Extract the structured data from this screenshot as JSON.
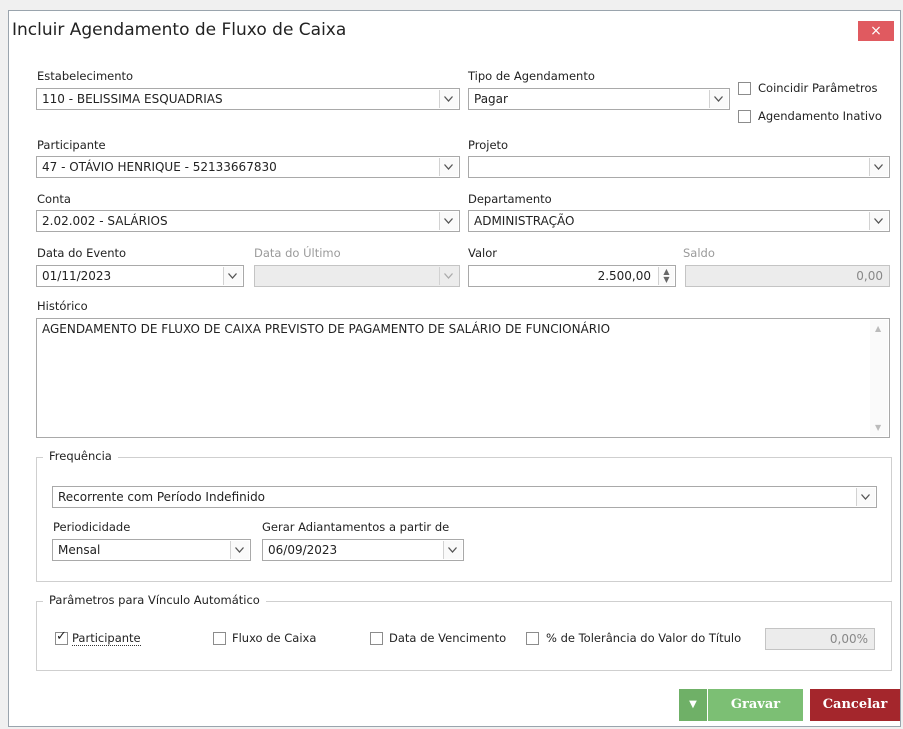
{
  "dialog": {
    "title": "Incluir Agendamento de Fluxo de Caixa",
    "close_label": "×"
  },
  "form": {
    "estabelecimento": {
      "label": "Estabelecimento",
      "value": "110 - BELISSIMA ESQUADRIAS"
    },
    "tipo_agendamento": {
      "label": "Tipo de Agendamento",
      "value": "Pagar"
    },
    "coincidir_parametros": {
      "label": "Coincidir Parâmetros",
      "checked": false
    },
    "agendamento_inativo": {
      "label": "Agendamento Inativo",
      "checked": false
    },
    "participante": {
      "label": "Participante",
      "value": "47 - OTÁVIO HENRIQUE - 52133667830"
    },
    "projeto": {
      "label": "Projeto",
      "value": ""
    },
    "conta": {
      "label": "Conta",
      "value": "2.02.002 - SALÁRIOS"
    },
    "departamento": {
      "label": "Departamento",
      "value": "ADMINISTRAÇÃO"
    },
    "data_evento": {
      "label": "Data do Evento",
      "value": "01/11/2023"
    },
    "data_ultimo": {
      "label": "Data do Último",
      "value": ""
    },
    "valor": {
      "label": "Valor",
      "value": "2.500,00"
    },
    "saldo": {
      "label": "Saldo",
      "value": "0,00"
    },
    "historico": {
      "label": "Histórico",
      "value": "AGENDAMENTO DE FLUXO DE CAIXA PREVISTO DE PAGAMENTO DE SALÁRIO DE FUNCIONÁRIO"
    }
  },
  "frequencia": {
    "legend": "Frequência",
    "tipo": "Recorrente com Período Indefinido",
    "periodicidade": {
      "label": "Periodicidade",
      "value": "Mensal"
    },
    "gerar": {
      "label": "Gerar Adiantamentos a partir de",
      "value": "06/09/2023"
    }
  },
  "vinculo": {
    "legend": "Parâmetros para Vínculo Automático",
    "participante": {
      "label": "Participante",
      "checked": true
    },
    "fluxo_caixa": {
      "label": "Fluxo de Caixa",
      "checked": false
    },
    "data_vencimento": {
      "label": "Data de Vencimento",
      "checked": false
    },
    "tolerancia": {
      "label": "% de Tolerância do Valor do Título",
      "checked": false,
      "value": "0,00%"
    }
  },
  "buttons": {
    "menu_label": "▼",
    "save_label": "Gravar",
    "cancel_label": "Cancelar"
  },
  "colors": {
    "save": "#7cbf74",
    "save_menu": "#6fb067",
    "cancel": "#a4262c",
    "close": "#e05a60"
  }
}
